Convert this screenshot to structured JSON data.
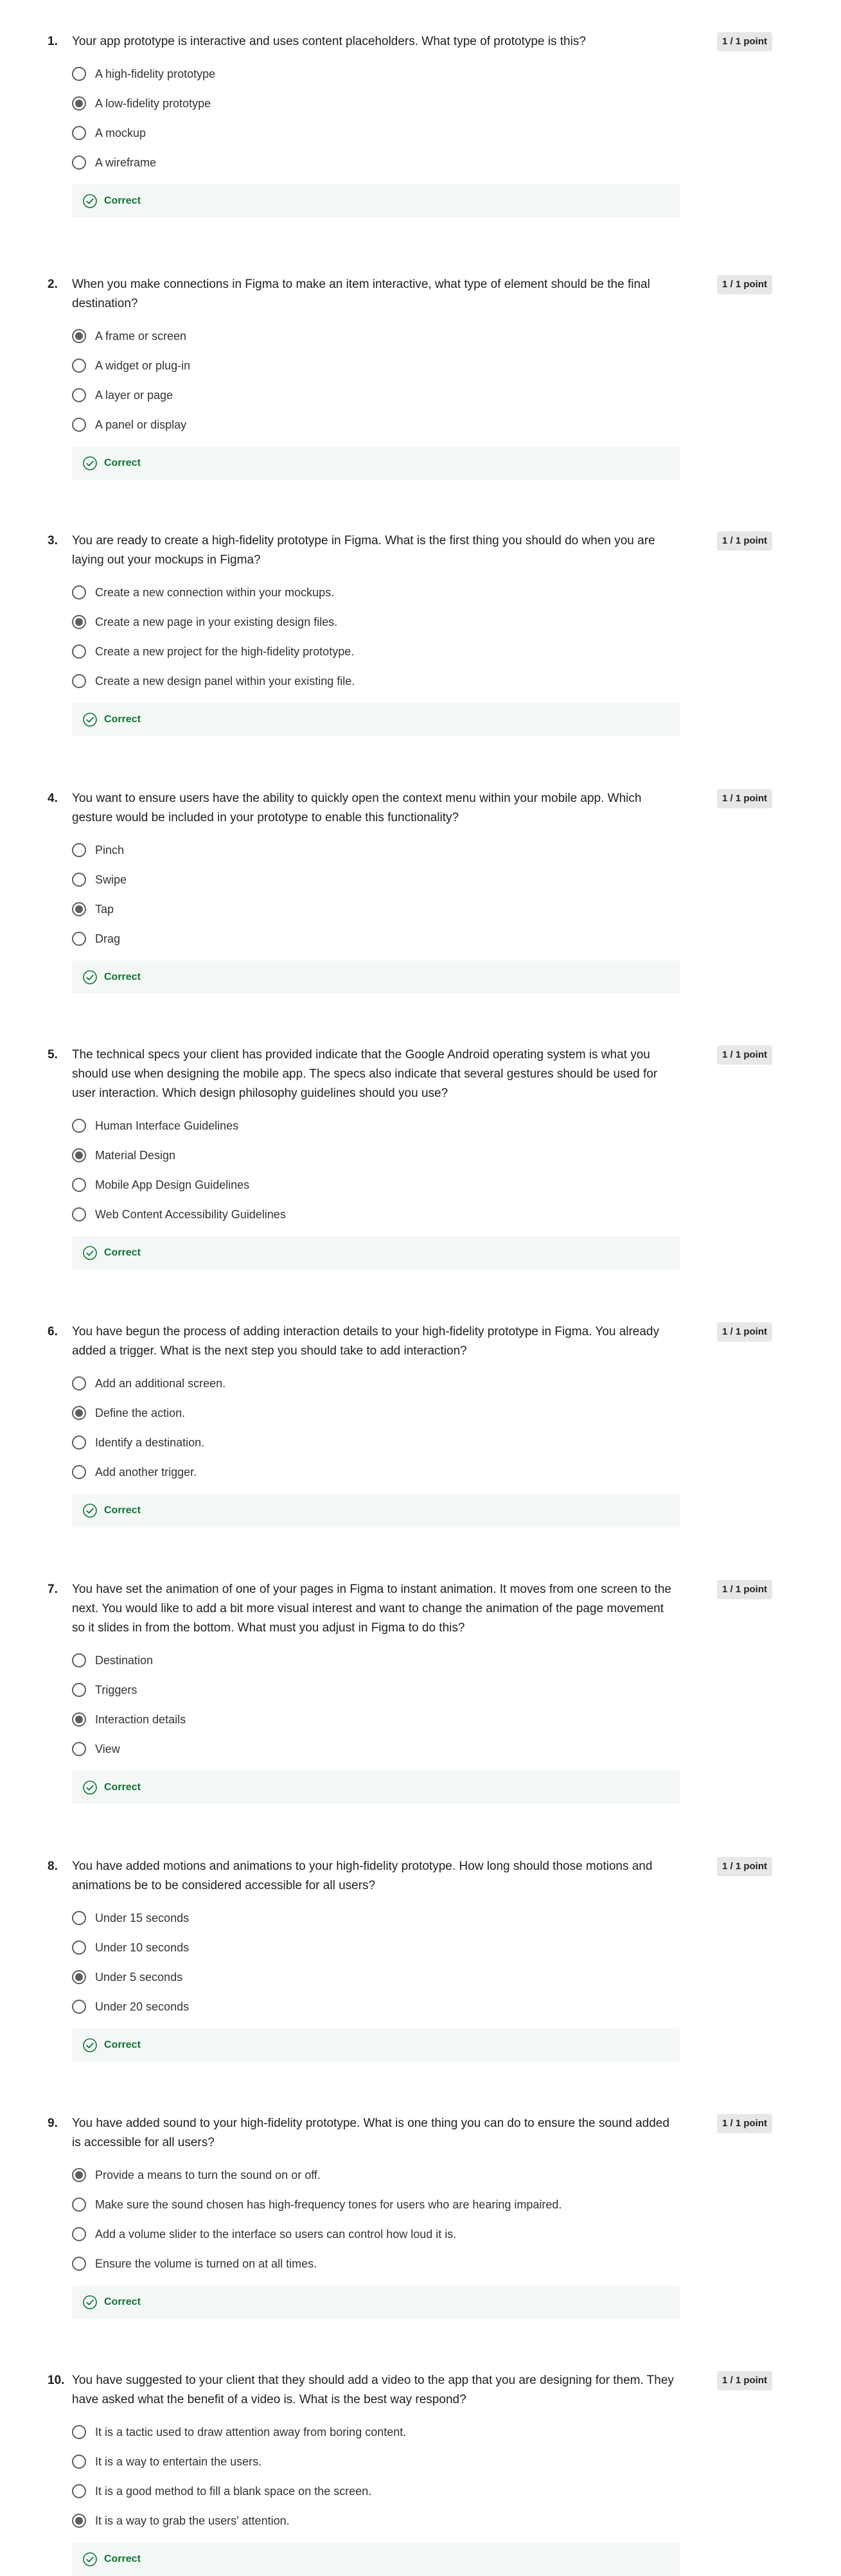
{
  "feedback_label": "Correct",
  "questions": [
    {
      "number": "1.",
      "text": "Your app prototype is interactive and uses content placeholders. What type of prototype is this?",
      "points": "1 / 1 point",
      "options": [
        "A high-fidelity prototype",
        "A low-fidelity prototype",
        "A mockup",
        "A wireframe"
      ],
      "selected": 1
    },
    {
      "number": "2.",
      "text": "When you make connections in Figma to make an item interactive, what type of element should be the final destination?",
      "points": "1 / 1 point",
      "options": [
        "A frame or screen",
        "A widget or plug-in",
        "A layer or page",
        "A panel or display"
      ],
      "selected": 0
    },
    {
      "number": "3.",
      "text": "You are ready to create a high-fidelity prototype in Figma. What is the first thing you should do when you are laying out your mockups in Figma?",
      "points": "1 / 1 point",
      "options": [
        "Create a new connection within your mockups.",
        "Create a new page in your existing design files.",
        "Create a new project for the high-fidelity prototype.",
        "Create a new design panel within your existing file."
      ],
      "selected": 1
    },
    {
      "number": "4.",
      "text": "You want to ensure users have the ability to quickly open the context menu within your mobile app. Which gesture would be included in your prototype to enable this functionality?",
      "points": "1 / 1 point",
      "options": [
        "Pinch",
        "Swipe",
        "Tap",
        "Drag"
      ],
      "selected": 2
    },
    {
      "number": "5.",
      "text": "The technical specs your client has provided indicate that the Google Android operating system is what you should use when designing the mobile app. The specs also indicate that several gestures should be used for user interaction. Which design philosophy guidelines should you use?",
      "points": "1 / 1 point",
      "options": [
        "Human Interface Guidelines",
        "Material Design",
        "Mobile App Design Guidelines",
        "Web Content Accessibility Guidelines"
      ],
      "selected": 1
    },
    {
      "number": "6.",
      "text": "You have begun the process of adding interaction details to your high-fidelity prototype in Figma. You already added a trigger. What is the next step you should take to add interaction?",
      "points": "1 / 1 point",
      "options": [
        "Add an additional screen.",
        "Define the action.",
        "Identify a destination.",
        "Add another trigger."
      ],
      "selected": 1
    },
    {
      "number": "7.",
      "text": "You have set the animation of one of your pages in Figma to instant animation. It moves from one screen to the next. You would like to add a bit more visual interest and want to change the animation of the page movement so it slides in from the bottom. What must you adjust in Figma to do this?",
      "points": "1 / 1 point",
      "options": [
        "Destination",
        "Triggers",
        "Interaction details",
        "View"
      ],
      "selected": 2
    },
    {
      "number": "8.",
      "text": "You have added motions and animations to your high-fidelity prototype. How long should those motions and animations be to be considered accessible for all users?",
      "points": "1 / 1 point",
      "options": [
        "Under 15 seconds",
        "Under 10 seconds",
        "Under 5 seconds",
        "Under 20 seconds"
      ],
      "selected": 2
    },
    {
      "number": "9.",
      "text": "You have added sound to your high-fidelity prototype. What is one thing you can do to ensure the sound added is accessible for all users?",
      "points": "1 / 1 point",
      "options": [
        "Provide a means to turn the sound on or off.",
        "Make sure the sound chosen has high-frequency tones for users who are hearing impaired.",
        "Add a volume slider to the interface so users can control how loud it is.",
        "Ensure the volume is turned on at all times."
      ],
      "selected": 0
    },
    {
      "number": "10.",
      "text": "You have suggested to your client that they should add a video to the app that you are designing for them. They have asked what the benefit of a video is. What is the best way respond?",
      "points": "1 / 1 point",
      "options": [
        "It is a tactic used to draw attention away from boring content.",
        "It is a way to entertain the users.",
        "It is a good method to fill a blank space on the screen.",
        "It is a way to grab the users' attention."
      ],
      "selected": 3
    }
  ]
}
